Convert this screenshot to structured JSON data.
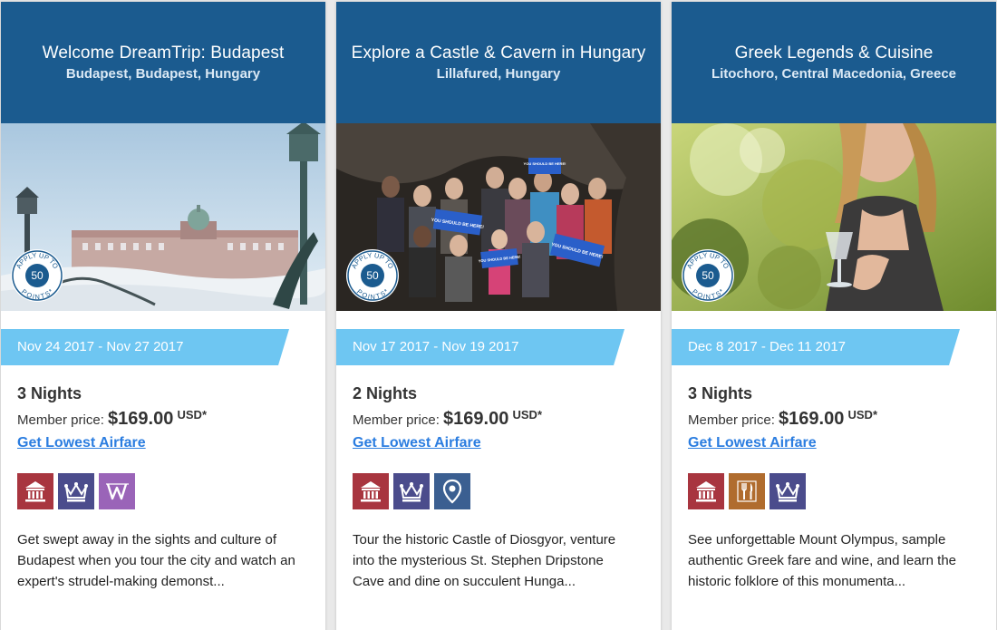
{
  "colors": {
    "header_bg": "#1b5b8f",
    "date_strip": "#6ec6f2",
    "link": "#2b7de0",
    "icon_museum": "#a8353f",
    "icon_crown": "#4b4c8c",
    "icon_wine_w": "#9a64b8",
    "icon_location": "#3b5f91",
    "icon_dining": "#b06c2e"
  },
  "cards": [
    {
      "title": "Welcome DreamTrip: Budapest",
      "location": "Budapest, Budapest, Hungary",
      "points_label": "APPLY UP TO",
      "points_value": "50",
      "points_suffix": "POINTS*",
      "dates": "Nov 24 2017 - Nov 27 2017",
      "nights": "3 Nights",
      "price_label": "Member price:",
      "price": "$169.00",
      "currency": "USD*",
      "airfare_link": "Get Lowest Airfare",
      "icons": [
        "museum-icon",
        "crown-icon",
        "w-icon"
      ],
      "description": "Get swept away in the sights and culture of Budapest when you tour the city and watch an expert's strudel-making demonst..."
    },
    {
      "title": "Explore a Castle & Cavern in Hungary",
      "location": "Lillafured, Hungary",
      "points_label": "APPLY UP TO",
      "points_value": "50",
      "points_suffix": "POINTS*",
      "dates": "Nov 17 2017 - Nov 19 2017",
      "nights": "2 Nights",
      "price_label": "Member price:",
      "price": "$169.00",
      "currency": "USD*",
      "airfare_link": "Get Lowest Airfare",
      "icons": [
        "museum-icon",
        "crown-icon",
        "location-pin-icon"
      ],
      "image_signs": [
        "YOU SHOULD BE HERE!",
        "YOU SHOULD BE HERE!",
        "YOU SHOULD BE HERE!",
        "YOU SHOULD BE HERE!"
      ],
      "description": "Tour the historic Castle of Diosgyor, venture into the mysterious St. Stephen Dripstone Cave and dine on succulent Hunga..."
    },
    {
      "title": "Greek Legends & Cuisine",
      "location": "Litochoro, Central Macedonia, Greece",
      "points_label": "APPLY UP TO",
      "points_value": "50",
      "points_suffix": "POINTS*",
      "dates": "Dec 8 2017 - Dec 11 2017",
      "nights": "3 Nights",
      "price_label": "Member price:",
      "price": "$169.00",
      "currency": "USD*",
      "airfare_link": "Get Lowest Airfare",
      "icons": [
        "museum-icon",
        "dining-icon",
        "crown-icon"
      ],
      "description": "See unforgettable Mount Olympus, sample authentic Greek fare and wine, and learn the historic folklore of this monumenta..."
    }
  ]
}
